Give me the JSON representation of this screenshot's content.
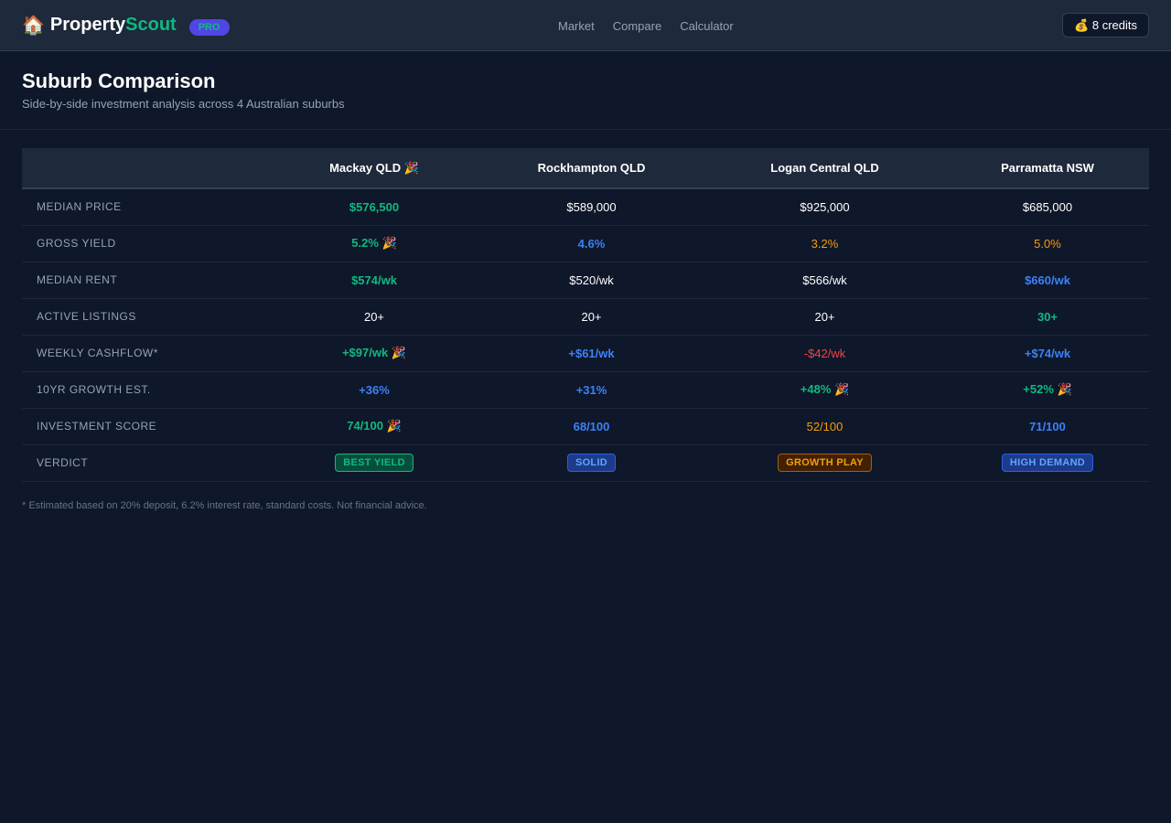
{
  "header": {
    "logo_icon": "🏠",
    "brand_part1": "Property",
    "brand_part2": "Scout",
    "badge": "PRO",
    "nav": [
      "Market",
      "Compare",
      "Calculator"
    ],
    "credits": "💰 8 credits"
  },
  "page": {
    "title": "Suburb Comparison",
    "subtitle": "Side-by-side investment analysis across 4 Australian suburbs"
  },
  "table": {
    "columns": [
      "Mackay QLD 🎉",
      "Rockhampton QLD",
      "Logan Central QLD",
      "Parramatta NSW"
    ],
    "rows": [
      {
        "label": "MEDIAN PRICE",
        "cells": [
          {
            "text": "$576,500",
            "tone": "green"
          },
          {
            "text": "$589,000",
            "tone": "white"
          },
          {
            "text": "$925,000",
            "tone": "white"
          },
          {
            "text": "$685,000",
            "tone": "white"
          }
        ]
      },
      {
        "label": "GROSS YIELD",
        "cells": [
          {
            "text": "5.2% 🎉",
            "tone": "green"
          },
          {
            "text": "4.6%",
            "tone": "blue"
          },
          {
            "text": "3.2%",
            "tone": "orange"
          },
          {
            "text": "5.0%",
            "tone": "orange"
          }
        ]
      },
      {
        "label": "MEDIAN RENT",
        "cells": [
          {
            "text": "$574/wk",
            "tone": "green"
          },
          {
            "text": "$520/wk",
            "tone": "white"
          },
          {
            "text": "$566/wk",
            "tone": "white"
          },
          {
            "text": "$660/wk",
            "tone": "blue"
          }
        ]
      },
      {
        "label": "ACTIVE LISTINGS",
        "cells": [
          {
            "text": "20+",
            "tone": "white"
          },
          {
            "text": "20+",
            "tone": "white"
          },
          {
            "text": "20+",
            "tone": "white"
          },
          {
            "text": "30+",
            "tone": "green"
          }
        ]
      },
      {
        "label": "WEEKLY CASHFLOW*",
        "cells": [
          {
            "text": "+$97/wk 🎉",
            "tone": "green"
          },
          {
            "text": "+$61/wk",
            "tone": "blue"
          },
          {
            "text": "-$42/wk",
            "tone": "red"
          },
          {
            "text": "+$74/wk",
            "tone": "blue"
          }
        ]
      },
      {
        "label": "10YR GROWTH EST.",
        "cells": [
          {
            "text": "+36%",
            "tone": "blue"
          },
          {
            "text": "+31%",
            "tone": "blue"
          },
          {
            "text": "+48% 🎉",
            "tone": "green"
          },
          {
            "text": "+52% 🎉",
            "tone": "green"
          }
        ]
      },
      {
        "label": "INVESTMENT SCORE",
        "cells": [
          {
            "text": "74/100 🎉",
            "tone": "green"
          },
          {
            "text": "68/100",
            "tone": "blue"
          },
          {
            "text": "52/100",
            "tone": "orange"
          },
          {
            "text": "71/100",
            "tone": "blue"
          }
        ]
      }
    ],
    "verdict": {
      "label": "VERDICT",
      "badges": [
        {
          "text": "BEST YIELD",
          "tone": "green"
        },
        {
          "text": "SOLID",
          "tone": "blue"
        },
        {
          "text": "GROWTH PLAY",
          "tone": "orange"
        },
        {
          "text": "HIGH DEMAND",
          "tone": "blue"
        }
      ]
    }
  },
  "footnote": "* Estimated based on 20% deposit, 6.2% interest rate, standard costs. Not financial advice.",
  "colors": {
    "background": "#0f172a",
    "panel": "#1e293b",
    "green": "#10b981",
    "blue": "#3b82f6",
    "orange": "#f59e0b",
    "red": "#ef4444",
    "pro_badge": "#4f46e5"
  }
}
